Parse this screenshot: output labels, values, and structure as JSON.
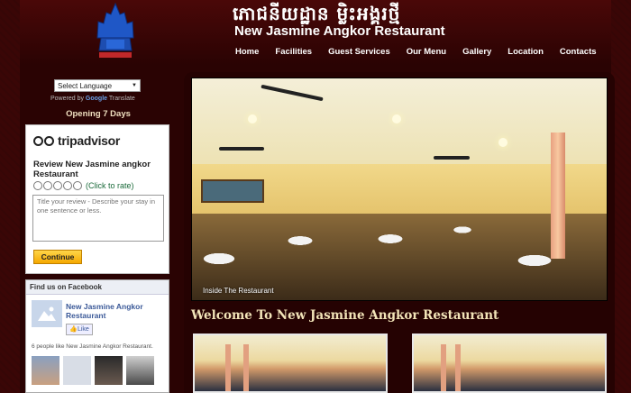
{
  "header": {
    "khmer_title": "ភោជនីយដ្ឋាន ម្លិះអង្គរថ្មី",
    "site_title": "New Jasmine Angkor  Restaurant",
    "logo_icon": "temple-logo-icon"
  },
  "nav": {
    "items": [
      "Home",
      "Facilities",
      "Guest Services",
      "Our Menu",
      "Gallery",
      "Location",
      "Contacts"
    ]
  },
  "translate": {
    "selected": "Select Language",
    "powered_by": "Powered by",
    "google": "Google",
    "translate_word": "Translate"
  },
  "opening": "Opening 7 Days",
  "tripadvisor": {
    "wordmark": "tripadvisor",
    "review_title": "Review New Jasmine angkor Restaurant",
    "rate_text": "(Click to rate)",
    "placeholder": "Title your review - Describe your stay in one sentence or less.",
    "continue_label": "Continue"
  },
  "facebook": {
    "header": "Find us on Facebook",
    "page_name": "New Jasmine Angkor Restaurant",
    "like_label": "Like",
    "likes_text": "6 people like New Jasmine Angkor Restaurant."
  },
  "main": {
    "photo_caption": "Inside The Restaurant",
    "welcome": "Welcome To New Jasmine Angkor Restaurant"
  },
  "colors": {
    "background": "#3a0606",
    "accent_gold": "#f2e4b8",
    "tripadvisor_green": "#1a6a3a",
    "facebook_blue": "#3b5998"
  }
}
